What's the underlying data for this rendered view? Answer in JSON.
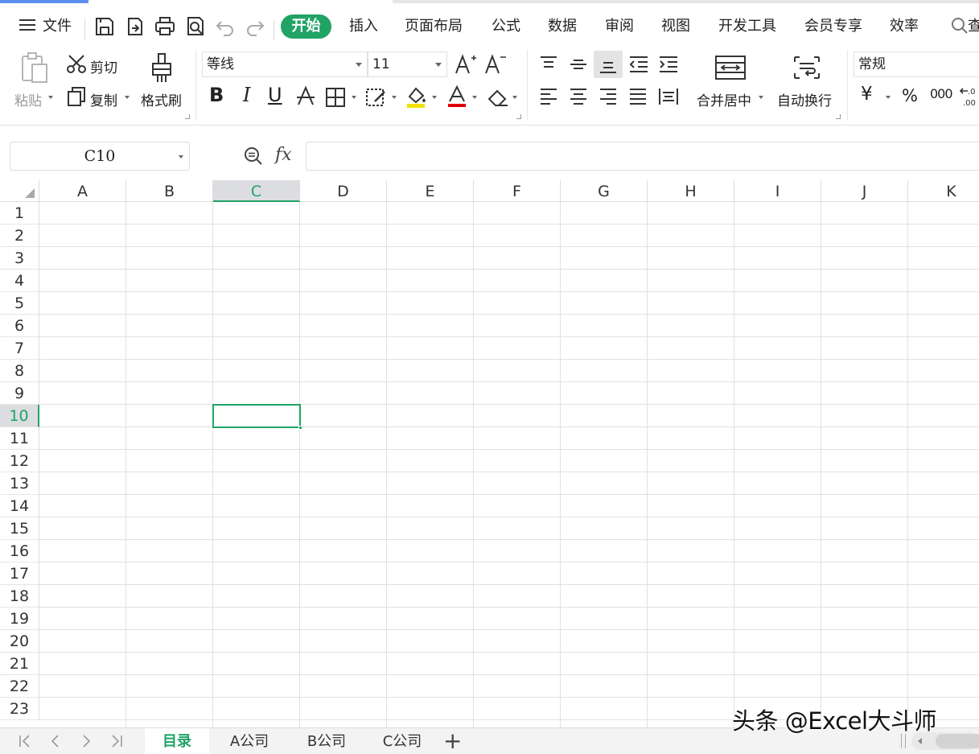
{
  "menu": {
    "file": "文件",
    "tabs": [
      "开始",
      "插入",
      "页面布局",
      "公式",
      "数据",
      "审阅",
      "视图",
      "开发工具",
      "会员专享",
      "效率"
    ],
    "search_partial": "查"
  },
  "ribbon": {
    "paste": "粘贴",
    "cut": "剪切",
    "copy": "复制",
    "format_painter": "格式刷",
    "font_name": "等线",
    "font_size": "11",
    "merge_center": "合并居中",
    "wrap_text": "自动换行",
    "number_format": "常规",
    "currency_symbol": "¥",
    "percent_symbol": "%",
    "thousands_symbol": "000",
    "bold": "B",
    "italic": "I",
    "underline": "U"
  },
  "formula_bar": {
    "name_box": "C10",
    "fx": "fx",
    "value": ""
  },
  "grid": {
    "columns": [
      "A",
      "B",
      "C",
      "D",
      "E",
      "F",
      "G",
      "H",
      "I",
      "J",
      "K"
    ],
    "rows": [
      "1",
      "2",
      "3",
      "4",
      "5",
      "6",
      "7",
      "8",
      "9",
      "10",
      "11",
      "12",
      "13",
      "14",
      "15",
      "16",
      "17",
      "18",
      "19",
      "20",
      "21",
      "22",
      "23"
    ],
    "selected_column": "C",
    "selected_row": "10"
  },
  "sheets": {
    "tabs": [
      "目录",
      "A公司",
      "B公司",
      "C公司"
    ],
    "active": "目录",
    "add": "+"
  },
  "watermark": "头条 @Excel大斗师",
  "colors": {
    "accent": "#21a366",
    "header_selected_bg": "#dcdde1",
    "gridline": "#e1e1e1"
  }
}
